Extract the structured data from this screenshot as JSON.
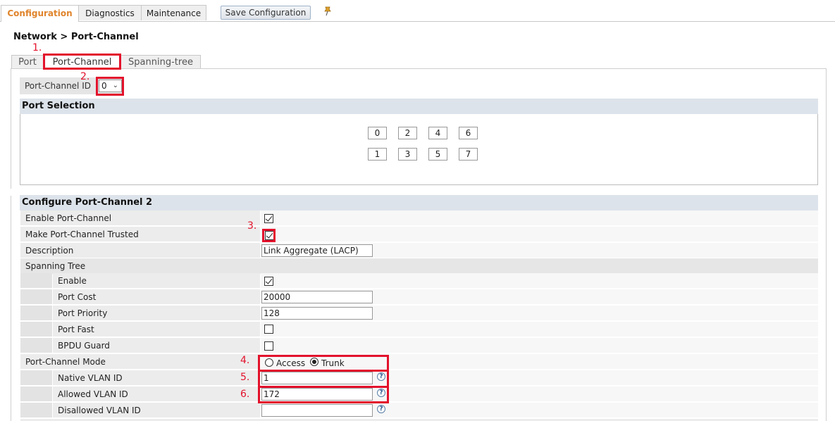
{
  "top_tabs": [
    {
      "label": "Configuration",
      "active": true
    },
    {
      "label": "Diagnostics",
      "active": false
    },
    {
      "label": "Maintenance",
      "active": false
    }
  ],
  "save_button": "Save Configuration",
  "pin_icon": "pin-icon",
  "breadcrumb": "Network > Port-Channel",
  "sub_tabs": [
    {
      "label": "Port",
      "active": false
    },
    {
      "label": "Port-Channel",
      "active": true
    },
    {
      "label": "Spanning-tree",
      "active": false
    }
  ],
  "port_channel_id": {
    "label": "Port-Channel ID",
    "value": "0"
  },
  "port_selection": {
    "title": "Port Selection",
    "row1": [
      "0",
      "2",
      "4",
      "6"
    ],
    "row2": [
      "1",
      "3",
      "5",
      "7"
    ]
  },
  "configure": {
    "title": "Configure Port-Channel 2",
    "enable_label": "Enable Port-Channel",
    "enable_checked": true,
    "trusted_label": "Make Port-Channel Trusted",
    "trusted_checked": true,
    "description_label": "Description",
    "description_value": "Link Aggregate (LACP)",
    "spanning_tree_label": "Spanning Tree",
    "st_enable_label": "Enable",
    "st_enable_checked": true,
    "port_cost_label": "Port Cost",
    "port_cost_value": "20000",
    "port_priority_label": "Port Priority",
    "port_priority_value": "128",
    "port_fast_label": "Port Fast",
    "port_fast_checked": false,
    "bpdu_guard_label": "BPDU Guard",
    "bpdu_guard_checked": false,
    "mode_label": "Port-Channel Mode",
    "mode_access": "Access",
    "mode_trunk": "Trunk",
    "mode_selected": "Trunk",
    "native_vlan_label": "Native VLAN ID",
    "native_vlan_value": "1",
    "allowed_vlan_label": "Allowed VLAN ID",
    "allowed_vlan_value": "172",
    "disallowed_vlan_label": "Disallowed VLAN ID",
    "disallowed_vlan_value": "",
    "help_glyph": "?"
  },
  "annotations": [
    "1.",
    "2.",
    "3.",
    "4.",
    "5.",
    "6."
  ],
  "colors": {
    "accent": "#e0842b",
    "annotation": "#e3122c",
    "section_header": "#dde3ea"
  }
}
